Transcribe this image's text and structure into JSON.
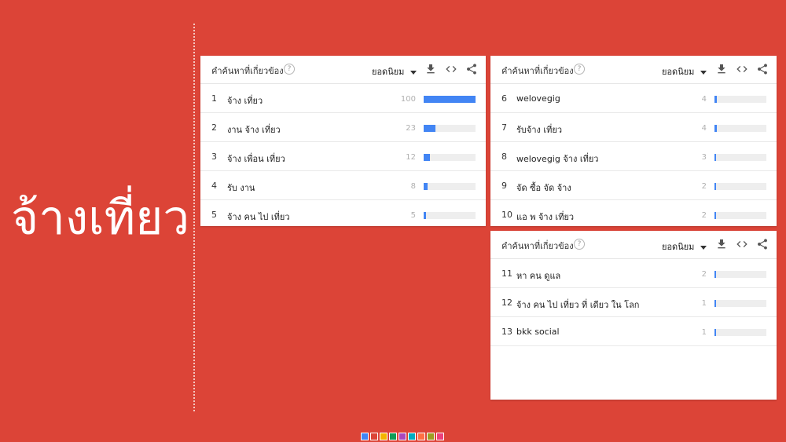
{
  "slide": {
    "title": "จ้างเที่ยว"
  },
  "card1": {
    "title": "คำค้นหาที่เกี่ยวข้อง",
    "sort_label": "ยอดนิยม",
    "rows": [
      {
        "rank": "1",
        "term": "จ้าง เที่ยว",
        "value": "100",
        "level": 100
      },
      {
        "rank": "2",
        "term": "งาน จ้าง เที่ยว",
        "value": "23",
        "level": 23
      },
      {
        "rank": "3",
        "term": "จ้าง เพื่อน เที่ยว",
        "value": "12",
        "level": 12
      },
      {
        "rank": "4",
        "term": "รับ งาน",
        "value": "8",
        "level": 8
      },
      {
        "rank": "5",
        "term": "จ้าง คน ไป เที่ยว",
        "value": "5",
        "level": 5
      }
    ]
  },
  "card2": {
    "title": "คำค้นหาที่เกี่ยวข้อง",
    "sort_label": "ยอดนิยม",
    "rows": [
      {
        "rank": "6",
        "term": "welovegig",
        "value": "4",
        "level": 4
      },
      {
        "rank": "7",
        "term": "รับจ้าง เที่ยว",
        "value": "4",
        "level": 4
      },
      {
        "rank": "8",
        "term": "welovegig จ้าง เที่ยว",
        "value": "3",
        "level": 3
      },
      {
        "rank": "9",
        "term": "จัด ซื้อ จัด จ้าง",
        "value": "2",
        "level": 2
      },
      {
        "rank": "10",
        "term": "แอ พ จ้าง เที่ยว",
        "value": "2",
        "level": 2
      }
    ]
  },
  "card3": {
    "title": "คำค้นหาที่เกี่ยวข้อง",
    "sort_label": "ยอดนิยม",
    "rows": [
      {
        "rank": "11",
        "term": "หา คน ดูแล",
        "value": "2",
        "level": 2
      },
      {
        "rank": "12",
        "term": "จ้าง คน ไป เที่ยว ที่ เดียว ใน โลก",
        "value": "1",
        "level": 1
      },
      {
        "rank": "13",
        "term": "bkk social",
        "value": "1",
        "level": 1
      }
    ]
  },
  "colors": {
    "background": "#DC4437",
    "bar": "#4285f4",
    "palette": [
      "#4285f4",
      "#db4437",
      "#f4b400",
      "#0f9d58",
      "#ab47bc",
      "#00acc1",
      "#ff7043",
      "#9e9d24",
      "#ec407a"
    ]
  },
  "icons": {
    "help": "help-circle-icon",
    "download": "download-icon",
    "embed": "code-embed-icon",
    "share": "share-icon"
  }
}
